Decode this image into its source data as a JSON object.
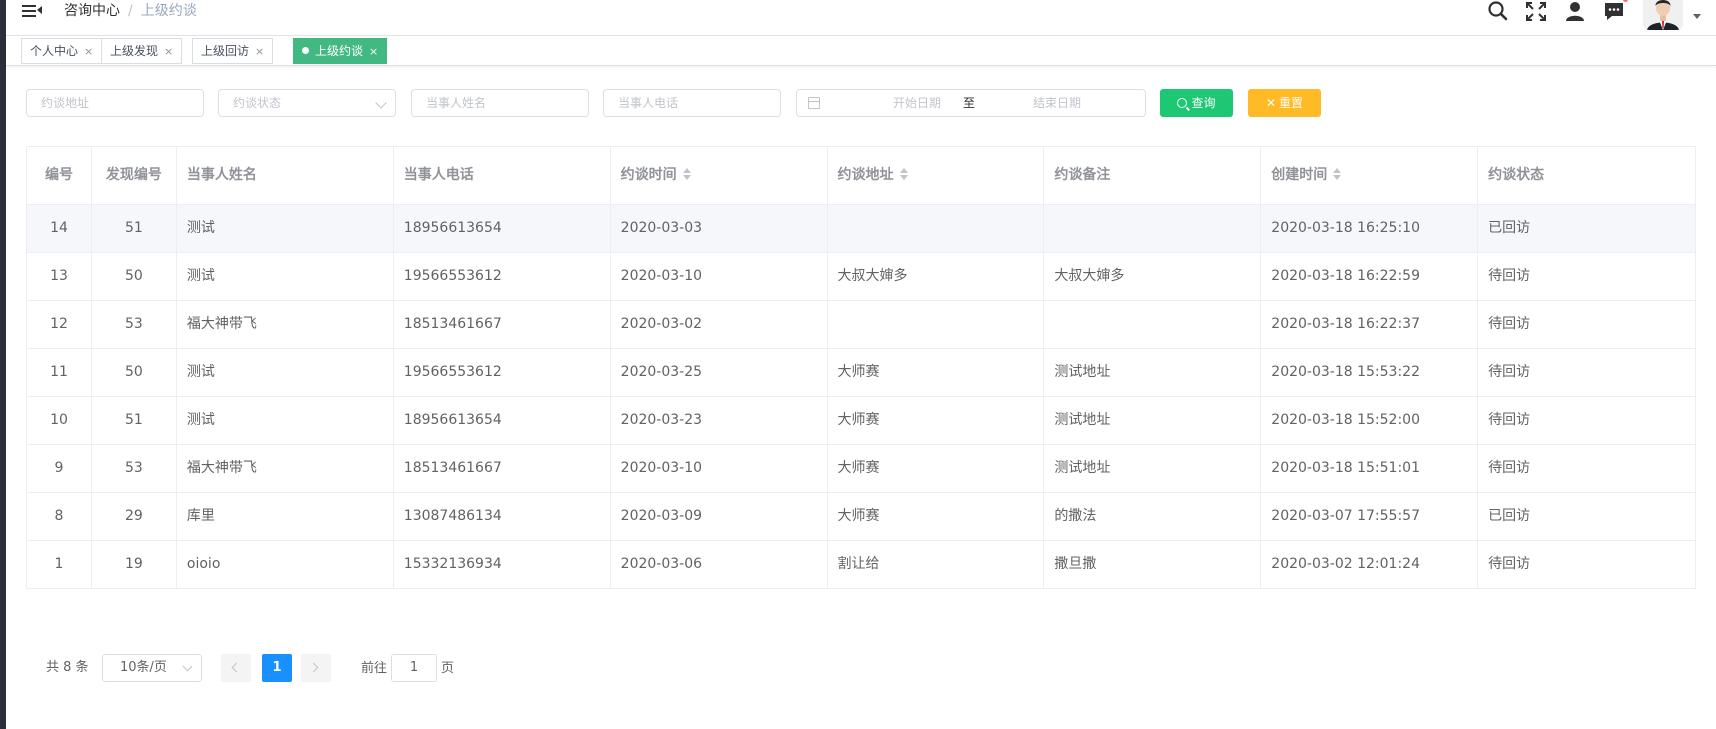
{
  "breadcrumb": {
    "first": "咨询中心",
    "separator": "/",
    "current": "上级约谈"
  },
  "header_icons": [
    "search-icon",
    "fullscreen-icon",
    "user-icon",
    "message-icon",
    "avatar"
  ],
  "tags": [
    {
      "label": "个人中心",
      "close": "×",
      "active": false
    },
    {
      "label": "上级发现",
      "close": "×",
      "active": false
    },
    {
      "label": "上级回访",
      "close": "×",
      "active": false
    },
    {
      "label": "上级约谈",
      "close": "×",
      "active": true
    }
  ],
  "filters": {
    "address_placeholder": "约谈地址",
    "status_placeholder": "约谈状态",
    "name_placeholder": "当事人姓名",
    "phone_placeholder": "当事人电话",
    "start_date_placeholder": "开始日期",
    "range_separator": "至",
    "end_date_placeholder": "结束日期",
    "search_label": "查询",
    "reset_label": "重置"
  },
  "table": {
    "columns": [
      "编号",
      "发现编号",
      "当事人姓名",
      "当事人电话",
      "约谈时间",
      "约谈地址",
      "约谈备注",
      "创建时间",
      "约谈状态"
    ],
    "rows": [
      [
        "14",
        "51",
        "测试",
        "18956613654",
        "2020-03-03",
        "",
        "",
        "2020-03-18 16:25:10",
        "已回访"
      ],
      [
        "13",
        "50",
        "测试",
        "19566553612",
        "2020-03-10",
        "大叔大婶多",
        "大叔大婶多",
        "2020-03-18 16:22:59",
        "待回访"
      ],
      [
        "12",
        "53",
        "福大神带飞",
        "18513461667",
        "2020-03-02",
        "",
        "",
        "2020-03-18 16:22:37",
        "待回访"
      ],
      [
        "11",
        "50",
        "测试",
        "19566553612",
        "2020-03-25",
        "大师赛",
        "测试地址",
        "2020-03-18 15:53:22",
        "待回访"
      ],
      [
        "10",
        "51",
        "测试",
        "18956613654",
        "2020-03-23",
        "大师赛",
        "测试地址",
        "2020-03-18 15:52:00",
        "待回访"
      ],
      [
        "9",
        "53",
        "福大神带飞",
        "18513461667",
        "2020-03-10",
        "大师赛",
        "测试地址",
        "2020-03-18 15:51:01",
        "待回访"
      ],
      [
        "8",
        "29",
        "库里",
        "13087486134",
        "2020-03-09",
        "大师赛",
        "的撒法",
        "2020-03-07 17:55:57",
        "已回访"
      ],
      [
        "1",
        "19",
        "oioio",
        "15332136934",
        "2020-03-06",
        "割让给",
        "撒旦撒",
        "2020-03-02 12:01:24",
        "待回访"
      ]
    ]
  },
  "pagination": {
    "total_text": "共 8 条",
    "page_size": "10条/页",
    "current_page": "1",
    "goto_label": "前往",
    "jump_value": "1",
    "page_suffix": "页"
  },
  "colors": {
    "accent_green": "#42b983",
    "search_green": "#1ec773",
    "reset_orange": "#ffba25",
    "page_blue": "#1890ff"
  }
}
